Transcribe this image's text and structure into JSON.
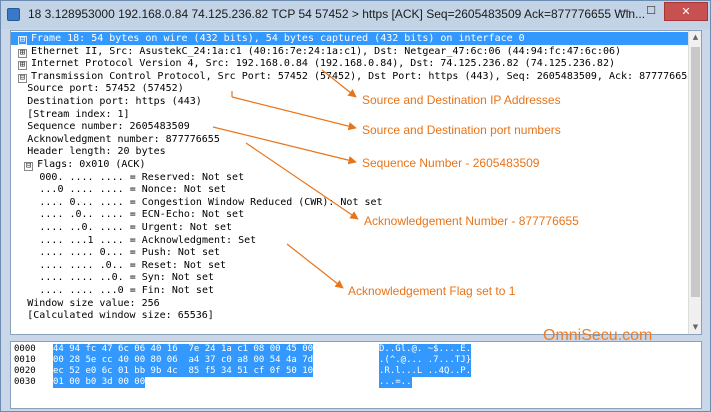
{
  "window": {
    "title": "18 3.128953000 192.168.0.84 74.125.236.82 TCP 54 57452 > https [ACK] Seq=2605483509 Ack=877776655 Win...",
    "min_glyph": "—",
    "max_glyph": "☐",
    "close_glyph": "✕"
  },
  "tree": [
    {
      "expander": "⊟",
      "text": "Frame 18: 54 bytes on wire (432 bits), 54 bytes captured (432 bits) on interface 0",
      "selected": true
    },
    {
      "expander": "⊞",
      "text": "Ethernet II, Src: AsustekC_24:1a:c1 (40:16:7e:24:1a:c1), Dst: Netgear_47:6c:06 (44:94:fc:47:6c:06)"
    },
    {
      "expander": "⊞",
      "text": "Internet Protocol Version 4, Src: 192.168.0.84 (192.168.0.84), Dst: 74.125.236.82 (74.125.236.82)"
    },
    {
      "expander": "⊟",
      "text": "Transmission Control Protocol, Src Port: 57452 (57452), Dst Port: https (443), Seq: 2605483509, Ack: 877776655"
    },
    {
      "text": "Source port: 57452 (57452)"
    },
    {
      "text": "Destination port: https (443)"
    },
    {
      "text": "[Stream index: 1]"
    },
    {
      "text": "Sequence number: 2605483509"
    },
    {
      "text": "Acknowledgment number: 877776655"
    },
    {
      "text": "Header length: 20 bytes"
    },
    {
      "expander": "⊟",
      "text": "Flags: 0x010 (ACK)"
    },
    {
      "text": "000. .... .... = Reserved: Not set"
    },
    {
      "text": "...0 .... .... = Nonce: Not set"
    },
    {
      "text": ".... 0... .... = Congestion Window Reduced (CWR): Not set"
    },
    {
      "text": ".... .0.. .... = ECN-Echo: Not set"
    },
    {
      "text": ".... ..0. .... = Urgent: Not set"
    },
    {
      "text": ".... ...1 .... = Acknowledgment: Set"
    },
    {
      "text": ".... .... 0... = Push: Not set"
    },
    {
      "text": ".... .... .0.. = Reset: Not set"
    },
    {
      "text": ".... .... ..0. = Syn: Not set"
    },
    {
      "text": ".... .... ...0 = Fin: Not set"
    },
    {
      "text": "Window size value: 256"
    },
    {
      "text": "[Calculated window size: 65536]"
    }
  ],
  "bytes": [
    {
      "offset": "0000",
      "hex": "44 94 fc 47 6c 06 40 16  7e 24 1a c1 08 00 45 00",
      "ascii": "D..Gl.@. ~$....E."
    },
    {
      "offset": "0010",
      "hex": "00 28 5e cc 40 00 80 06  a4 37 c0 a8 00 54 4a 7d",
      "ascii": ".(^.@... .7...TJ}"
    },
    {
      "offset": "0020",
      "hex": "ec 52 e0 6c 01 bb 9b 4c  85 f5 34 51 cf 0f 50 10",
      "ascii": ".R.l...L ..4Q..P."
    },
    {
      "offset": "0030",
      "hex": "01 00 b0 3d 00 00",
      "ascii": "...=.."
    }
  ],
  "annotations": {
    "ip": "Source and Destination IP Addresses",
    "ports": "Source and Destination port numbers",
    "seq": "Sequence Number - 2605483509",
    "ack": "Acknowledgement Number - 877776655",
    "flag": "Acknowledgement Flag set to 1",
    "color": "#e8741a"
  },
  "brand": "OmniSecu.com",
  "colors": {
    "selection": "#3399ff",
    "annotation": "#e8741a",
    "brand": "#ef7c22"
  }
}
